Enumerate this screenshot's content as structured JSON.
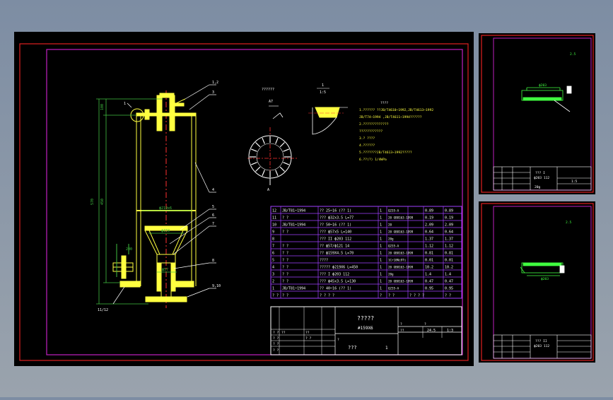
{
  "colors": {
    "canvas": "#000000",
    "outer_border": "#e02020",
    "inner_border": "#c020c0",
    "drawing": "#ffff40",
    "dims": "#40c040",
    "centerline": "#ff3030",
    "table_line": "#a040ff",
    "table_text": "#ffffff",
    "detail": "#40ff40"
  },
  "labels": {
    "title_main": "?????",
    "title_sub": "#159X6",
    "stamp_qq": "???",
    "stamp_one": "1",
    "view_a_title": "??????",
    "view_1_num": "1",
    "view_1_scale": "1:5",
    "notes_title": "????",
    "view_a_mark": "A",
    "callout_1": "1",
    "callout_112": "11/12"
  },
  "notes": [
    "1.?????? ??JB/T4610~1992,JB/T4613~1992",
    "  JB/T74~1994 ,JB/T4611~1994??????",
    "2.?????????????",
    "  ????????????",
    "3.? ????",
    "4.??????",
    "5.???????JB/T4613~1992?????",
    "6.??(?) 1/4WPa"
  ],
  "bom_rows": [
    {
      "no": "12",
      "std": "JB/T81~1994",
      "name": "?? 25~16 (?? 1)",
      "qty": "1",
      "mat": "Q235-A",
      "w1": "0.89",
      "w2": "0.89"
    },
    {
      "no": "11",
      "std": "? ?",
      "name": "???  ϕ32x3.5  L=77",
      "qty": "1",
      "mat": "20 GB8163-1999",
      "w1": "0.19",
      "w2": "0.19"
    },
    {
      "no": "10",
      "std": "JB/T81~1994",
      "name": "??  50~16  (?? 1)",
      "qty": "1",
      "mat": "20",
      "w1": "2.09",
      "w2": "2.09"
    },
    {
      "no": "9",
      "std": "? ?",
      "name": "???  ϕ57x5  L=140",
      "qty": "1",
      "mat": "20 GB8163-1999",
      "w1": "0.64",
      "w2": "0.64"
    },
    {
      "no": "8",
      "std": "",
      "name": "??? II ϕ203 112",
      "qty": "1",
      "mat": "20g",
      "w1": "1.37",
      "w2": "1.37"
    },
    {
      "no": "7",
      "std": "? ?",
      "name": "??  ϕ57/ϕ121 14",
      "qty": "1",
      "mat": "Q235-A",
      "w1": "1.12",
      "w2": "1.12"
    },
    {
      "no": "6",
      "std": "? ?",
      "name": "??  ϕ159X4.5  L=70",
      "qty": "1",
      "mat": "20 GB8163-1999",
      "w1": "0.81",
      "w2": "0.81"
    },
    {
      "no": "5",
      "std": "? ?",
      "name": "????",
      "qty": "1",
      "mat": "1Cr18Ni9Ti",
      "w1": "0.01",
      "w2": "0.01"
    },
    {
      "no": "4",
      "std": "? ?",
      "name": "?????  ϕ219X6  L=450",
      "qty": "1",
      "mat": "20 GB8163-1999",
      "w1": "10.2",
      "w2": "10.2"
    },
    {
      "no": "3",
      "std": "? ?",
      "name": "??? I ϕ203 112",
      "qty": "1",
      "mat": "20g",
      "w1": "1.4",
      "w2": "1.4"
    },
    {
      "no": "2",
      "std": "? ?",
      "name": "???  ϕ45x3.5  L=130",
      "qty": "1",
      "mat": "20 GB8163-1999",
      "w1": "0.47",
      "w2": "0.47"
    },
    {
      "no": "1",
      "std": "JB/T81~1994",
      "name": "??  40~16  (?? 1)",
      "qty": "1",
      "mat": "Q235-A",
      "w1": "0.95",
      "w2": "0.95"
    }
  ],
  "bom_header": [
    "? ?",
    "?  ?",
    "? ? ? ?",
    "?",
    "? ?",
    "? ? ? ?",
    "? ?"
  ],
  "title_block": {
    "weight_total": "24.5",
    "scale": "1:3",
    "rows_left": [
      "? ?",
      "? ?",
      "? ?",
      "? ?"
    ],
    "cells": [
      "? ?",
      "?",
      "??",
      "??",
      "??",
      "?",
      "?"
    ]
  },
  "sheet_2": {
    "part_title": "??? I",
    "part_sub": "ϕ203 112",
    "material": "20g",
    "scale": "1:5",
    "dim_top": "ϕ203",
    "detail_mark": "2.5"
  },
  "sheet_3": {
    "part_title": "??? II",
    "part_sub": "ϕ203 112",
    "detail_mark": "2.5",
    "dim_top": "ϕ203"
  },
  "dims_main": {
    "h_total": "570",
    "h_body": "450",
    "top_gap": "100",
    "d_body": "ϕ219x6",
    "d_inner": "ϕ159",
    "d_small": "ϕ57",
    "d_bottom": "200"
  },
  "callouts": [
    "1,2",
    "3",
    "4",
    "5",
    "6",
    "7",
    "8",
    "9,10"
  ]
}
